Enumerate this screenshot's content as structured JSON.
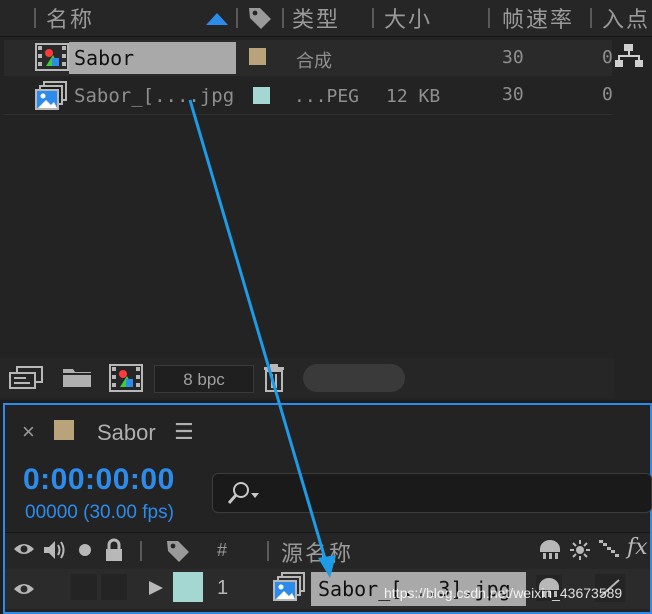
{
  "project": {
    "columns": {
      "name": "名称",
      "type": "类型",
      "size": "大小",
      "fps": "帧速率",
      "in": "入点"
    },
    "items": [
      {
        "name": "Sabor",
        "type": "合成",
        "size": "",
        "fps": "30",
        "in": "0",
        "label_color": "#b9a37b",
        "selected": true
      },
      {
        "name": "Sabor_[....jpg",
        "type": "...PEG",
        "size": "12 KB",
        "fps": "30",
        "in": "0",
        "label_color": "#a5d7d2",
        "selected": false
      }
    ],
    "bit_depth": "8 bpc"
  },
  "timeline": {
    "tab_title": "Sabor",
    "tab_color": "#b9a37b",
    "close_glyph": "×",
    "menu_glyph": "☰",
    "timecode": "0:00:00:00",
    "frames": "00000 (30.00 fps)",
    "header": {
      "hash": "#",
      "source_name": "源名称",
      "fx": "fx"
    },
    "layer": {
      "index": "1",
      "name": "Sabor_[...3].jpg",
      "label_color": "#a5d7d2"
    }
  },
  "watermark": "https://blog.csdn.net/weixin_43673589",
  "colors": {
    "accent": "#2d8ceb",
    "comp_label": "#b9a37b",
    "footage_label": "#a5d7d2"
  }
}
